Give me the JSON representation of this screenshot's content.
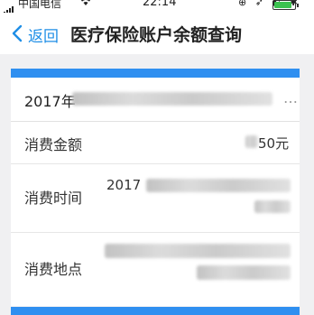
{
  "status_bar": {
    "carrier": "中国电信",
    "time": "22:14",
    "battery_level": 0.85,
    "battery_color": "#3cc24f"
  },
  "nav": {
    "back_label": "返回",
    "title": "医疗保险账户余额查询",
    "accent_color": "#1e8ee6"
  },
  "record": {
    "date_prefix": "2017年",
    "ellipsis": "…",
    "amount_label": "消费金额",
    "amount_value": "50元",
    "time_label": "消费时间",
    "time_value_prefix": "2017",
    "place_label": "消费地点"
  },
  "theme": {
    "card_bar_color": "#2f8ff0"
  }
}
